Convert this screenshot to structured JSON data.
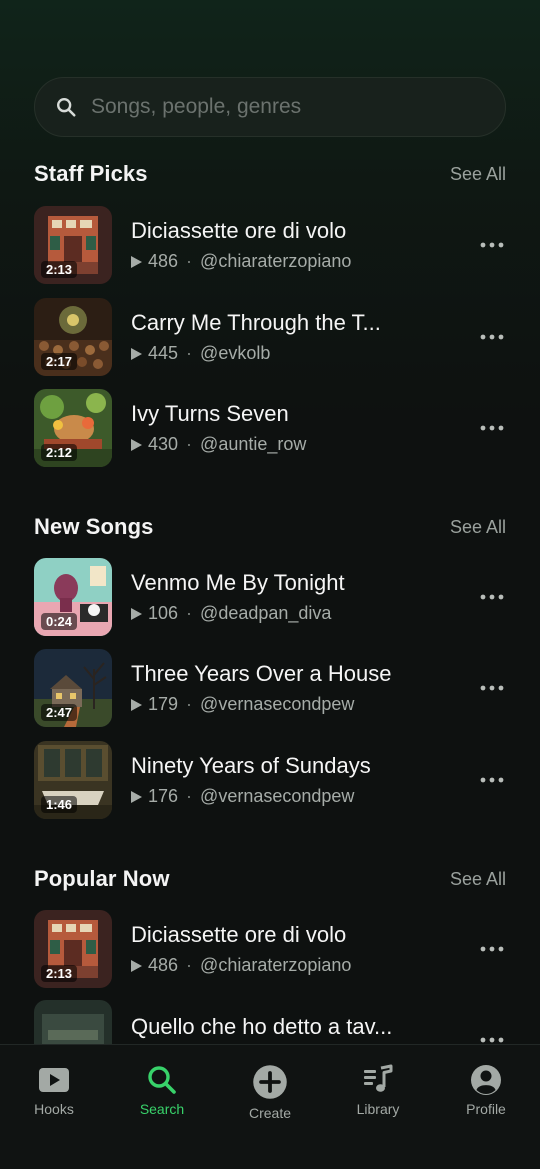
{
  "search": {
    "placeholder": "Songs, people, genres"
  },
  "sections": {
    "staff_picks": {
      "title": "Staff Picks",
      "see_all": "See All",
      "items": [
        {
          "title": "Diciassette ore di volo",
          "plays": "486",
          "artist": "@chiaraterzopiano",
          "duration": "2:13"
        },
        {
          "title": "Carry Me Through the T...",
          "plays": "445",
          "artist": "@evkolb",
          "duration": "2:17"
        },
        {
          "title": "Ivy Turns Seven",
          "plays": "430",
          "artist": "@auntie_row",
          "duration": "2:12"
        }
      ]
    },
    "new_songs": {
      "title": "New Songs",
      "see_all": "See All",
      "items": [
        {
          "title": "Venmo Me By Tonight",
          "plays": "106",
          "artist": "@deadpan_diva",
          "duration": "0:24"
        },
        {
          "title": "Three Years Over a House",
          "plays": "179",
          "artist": "@vernasecondpew",
          "duration": "2:47"
        },
        {
          "title": "Ninety Years of Sundays",
          "plays": "176",
          "artist": "@vernasecondpew",
          "duration": "1:46"
        }
      ]
    },
    "popular_now": {
      "title": "Popular Now",
      "see_all": "See All",
      "items": [
        {
          "title": "Diciassette ore di volo",
          "plays": "486",
          "artist": "@chiaraterzopiano",
          "duration": "2:13"
        },
        {
          "title": "Quello che ho detto a tav..."
        }
      ]
    }
  },
  "nav": {
    "tabs": [
      {
        "label": "Hooks",
        "icon": "play-square-icon"
      },
      {
        "label": "Search",
        "icon": "search-icon",
        "active": true
      },
      {
        "label": "Create",
        "icon": "plus-circle-icon"
      },
      {
        "label": "Library",
        "icon": "music-library-icon"
      },
      {
        "label": "Profile",
        "icon": "profile-icon"
      }
    ]
  },
  "colors": {
    "accent": "#38d26a",
    "background": "#0e1110",
    "muted_text": "#a6aca8"
  }
}
